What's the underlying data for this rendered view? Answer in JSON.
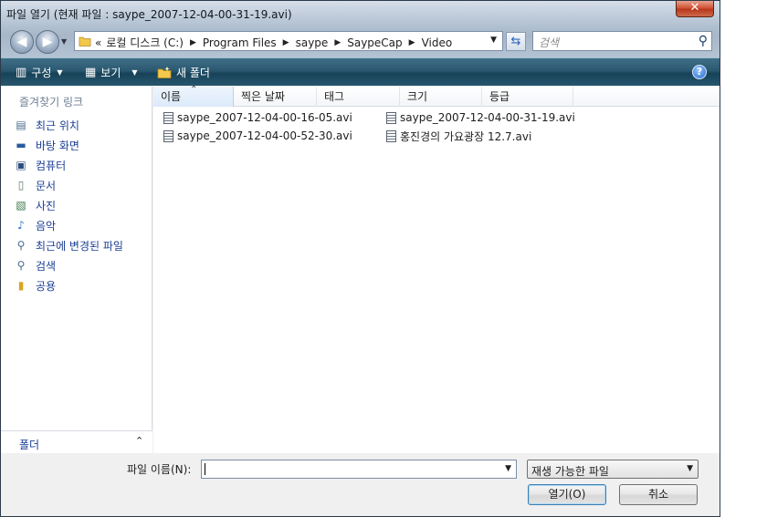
{
  "window": {
    "title": "파일 열기 (현재 파일 : saype_2007-12-04-00-31-19.avi)",
    "close_glyph": "✕"
  },
  "navigation": {
    "back_glyph": "◀",
    "forward_glyph": "▶",
    "breadcrumb_lead": "«",
    "breadcrumbs": [
      "로컬 디스크 (C:)",
      "Program Files",
      "saype",
      "SaypeCap",
      "Video"
    ],
    "search_placeholder": "검색"
  },
  "command_bar": {
    "organize_label": "구성",
    "views_label": "보기",
    "new_folder_label": "새 폴더",
    "help_glyph": "?"
  },
  "nav_pane": {
    "favorites_heading": "즐겨찾기 링크",
    "items": [
      {
        "label": "최근 위치",
        "icon": "recent-places-icon"
      },
      {
        "label": "바탕 화면",
        "icon": "desktop-icon"
      },
      {
        "label": "컴퓨터",
        "icon": "computer-icon"
      },
      {
        "label": "문서",
        "icon": "documents-icon"
      },
      {
        "label": "사진",
        "icon": "pictures-icon"
      },
      {
        "label": "음악",
        "icon": "music-icon"
      },
      {
        "label": "최근에 변경된 파일",
        "icon": "recently-changed-icon"
      },
      {
        "label": "검색",
        "icon": "searches-icon"
      },
      {
        "label": "공용",
        "icon": "public-folder-icon"
      }
    ],
    "folders_label": "폴더"
  },
  "file_list": {
    "columns": [
      "이름",
      "찍은 날짜",
      "태그",
      "크기",
      "등급"
    ],
    "files": [
      "saype_2007-12-04-00-16-05.avi",
      "saype_2007-12-04-00-52-30.avi",
      "saype_2007-12-04-00-31-19.avi",
      "홍진경의 가요광장 12.7.avi"
    ]
  },
  "bottom": {
    "filename_label": "파일 이름(N):",
    "filename_value": "",
    "filetype_value": "재생 가능한 파일",
    "open_label": "열기(O)",
    "cancel_label": "취소"
  }
}
